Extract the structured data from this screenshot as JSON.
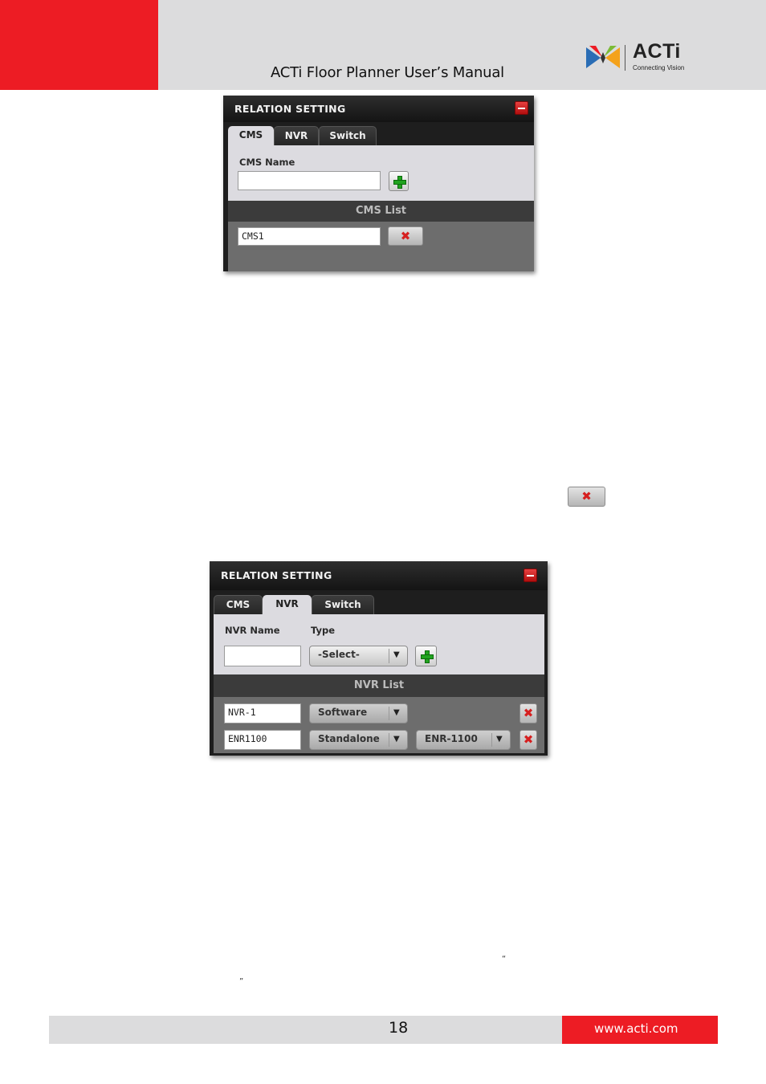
{
  "header": {
    "title": "ACTi Floor Planner User’s Manual",
    "logo_word": "ACTi",
    "logo_tagline": "Connecting Vision"
  },
  "cms_panel": {
    "title": "RELATION SETTING",
    "tabs": [
      "CMS",
      "NVR",
      "Switch"
    ],
    "active_tab": "CMS",
    "name_label": "CMS Name",
    "name_value": "",
    "list_header": "CMS List",
    "items": [
      {
        "name": "CMS1"
      }
    ]
  },
  "inline_delete_icon": "delete-x-icon",
  "nvr_panel": {
    "title": "RELATION SETTING",
    "tabs": [
      "CMS",
      "NVR",
      "Switch"
    ],
    "active_tab": "NVR",
    "name_label": "NVR Name",
    "type_label": "Type",
    "name_value": "",
    "type_select": "-Select-",
    "list_header": "NVR List",
    "items": [
      {
        "name": "NVR-1",
        "type": "Software"
      },
      {
        "name": "ENR1100",
        "type": "Standalone",
        "model": "ENR-1100"
      }
    ]
  },
  "quotes": {
    "open": "“",
    "close": "”"
  },
  "footer": {
    "page_number": "18",
    "url": "www.acti.com"
  },
  "colors": {
    "brand_red": "#ed1c24",
    "header_gray": "#dcdcdd",
    "add_green": "#21a31f",
    "delete_red": "#d61f1f"
  }
}
